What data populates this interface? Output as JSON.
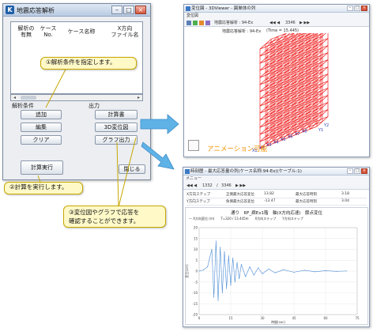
{
  "main_dialog": {
    "title": "地震応答解析",
    "columns": [
      "解析の\n有無",
      "ケース\nNo.",
      "ケース名称",
      "X方向\nファイル名"
    ],
    "conditions_label": "解析条件",
    "output_label": "出力",
    "add_button": "追加",
    "edit_button": "編集",
    "clear_button": "クリア",
    "report_button": "計算書",
    "displacement_button": "3D変位図",
    "graph_button": "グラフ出力",
    "run_button": "計算実行",
    "close_button": "閉じる"
  },
  "callouts": {
    "step1": "①解析条件を指定します。",
    "step2": "②計算を実行します。",
    "step3_line1": "③変位図やグラフで応答を",
    "step3_line2": "確認することができます。"
  },
  "viewer": {
    "title": "変位図 - 3DViewer - 図単体の列",
    "menu": "変位図",
    "toolbar_frame": "3346",
    "toolbar_case": "地震応答解析 : 94-Ex",
    "info_title": "地震応答解析 : 94-Ex",
    "info_time": "(Time = 15.445)",
    "animation_label": "アニメーション可能",
    "x_axis_labels": [
      "X1",
      "X2",
      "X3",
      "X4",
      "X5",
      "X6",
      "X7",
      "X8"
    ],
    "y_axis_labels": [
      "Y1",
      "Y2"
    ]
  },
  "graph_window": {
    "title": "時刻歴 - 最大応答量の列(ケース名称:94-Ex)(ケーブル:1)",
    "menu": "メニュー",
    "frame_value": "1332",
    "frame_total": "3346",
    "info_rows": [
      {
        "label": "X方向ステップ",
        "k1": "正側最大応答変位",
        "v1": "13.82",
        "k2": "最大応答時刻",
        "v2": "3.18"
      },
      {
        "label": "Y方向ステップ",
        "k1": "負側最大応答変位",
        "v1": "-13.47",
        "k2": "最大応答時刻",
        "v2": "3.04"
      }
    ],
    "legend": [
      "X方向変位 (m)",
      "T=320 / 13.445m",
      "X方向ステップ",
      "Y方向ステップ"
    ],
    "chart_title": "通り　RF_廊Ex1階　軸(X方向応速)　節点変位"
  },
  "chart_data": {
    "type": "line",
    "title": "通り　RF_廊Ex1階　軸(X方向応速)　節点変位",
    "xlabel": "時間(sec)",
    "ylabel": "変位(cm)",
    "xlim": [
      0,
      75
    ],
    "ylim": [
      -20,
      20
    ],
    "x_ticks": [
      0,
      15,
      30,
      45,
      60,
      75
    ],
    "y_ticks": [
      20,
      15,
      10,
      5,
      0,
      -5,
      -10,
      -15,
      -20
    ],
    "series": [
      {
        "name": "X方向変位 (m)",
        "color": "#4a8bd6",
        "x": [
          0,
          2,
          4,
          5,
          6,
          7,
          8,
          9,
          10,
          11,
          12,
          13,
          14,
          15,
          16,
          17,
          18,
          19,
          20,
          22,
          24,
          26,
          28,
          30,
          33,
          36,
          40,
          45,
          50,
          55,
          60,
          65,
          70
        ],
        "y": [
          0,
          0.5,
          2,
          6,
          10,
          -12,
          13.8,
          -13.5,
          11,
          -10,
          9,
          -8,
          7,
          -6.5,
          6,
          -5,
          4,
          -3.5,
          3,
          -2.5,
          2,
          -1.8,
          1.5,
          -1.2,
          1,
          -0.8,
          0.6,
          -0.5,
          0.4,
          -0.3,
          0.2,
          -0.1,
          0.05
        ]
      }
    ]
  }
}
